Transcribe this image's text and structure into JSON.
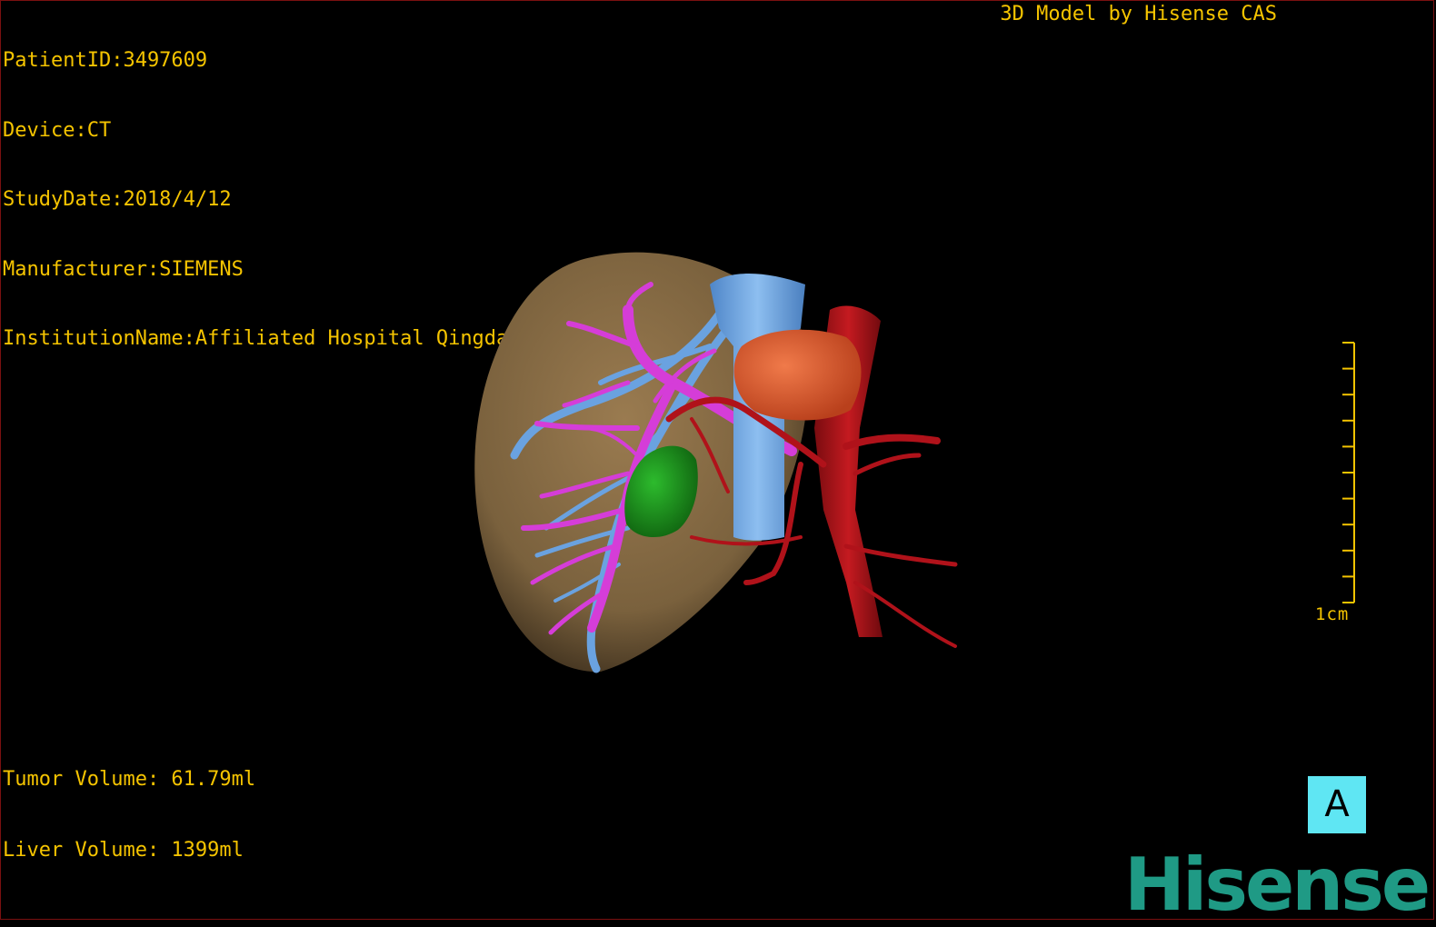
{
  "info": {
    "patient_id": "PatientID:3497609",
    "device": "Device:CT",
    "study_date": "StudyDate:2018/4/12",
    "manufacturer": "Manufacturer:SIEMENS",
    "institution": "InstitutionName:Affiliated Hospital Qingdao University-C"
  },
  "header": {
    "model_caption": "3D Model by Hisense CAS"
  },
  "volumes": {
    "tumor": "Tumor Volume: 61.79ml",
    "liver": "Liver Volume: 1399ml"
  },
  "scale_bar": {
    "label": "1cm"
  },
  "orientation": {
    "label": "A"
  },
  "logo": {
    "text": "Hisense"
  },
  "colors": {
    "overlay_text": "#f5c400",
    "liver": "#8a6e44",
    "portal_vein": "#d53dd8",
    "hepatic_vein": "#6aa2e0",
    "artery": "#b0121a",
    "tumor": "#e0562c",
    "gallbladder": "#1e8a1e",
    "orientation_box": "#5fe6f3",
    "logo": "#1f9a85"
  }
}
